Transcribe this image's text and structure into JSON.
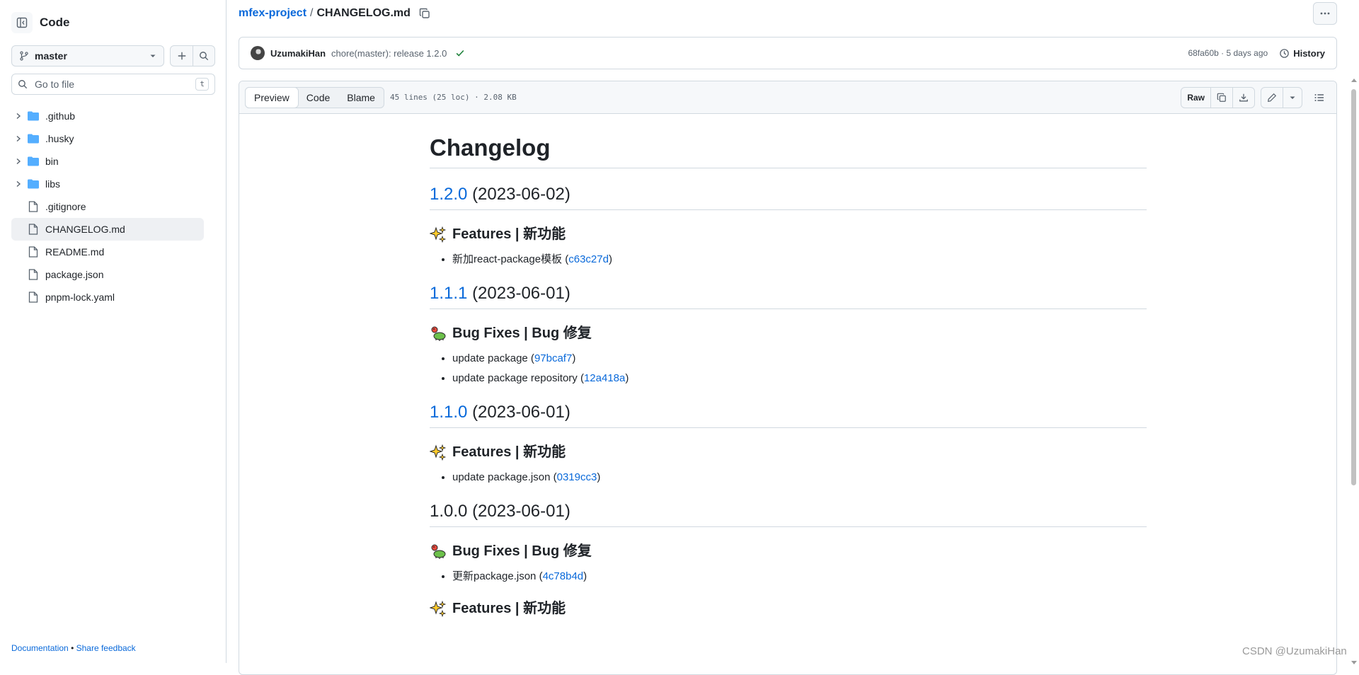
{
  "sidebar": {
    "title": "Code",
    "branch": "master",
    "goto": {
      "placeholder": "Go to file",
      "shortcut": "t"
    },
    "tree": [
      {
        "name": ".github",
        "type": "folder"
      },
      {
        "name": ".husky",
        "type": "folder"
      },
      {
        "name": "bin",
        "type": "folder"
      },
      {
        "name": "libs",
        "type": "folder"
      },
      {
        "name": ".gitignore",
        "type": "file"
      },
      {
        "name": "CHANGELOG.md",
        "type": "file",
        "active": true
      },
      {
        "name": "README.md",
        "type": "file"
      },
      {
        "name": "package.json",
        "type": "file"
      },
      {
        "name": "pnpm-lock.yaml",
        "type": "file"
      }
    ],
    "footer": {
      "documentation": "Documentation",
      "separator": "•",
      "feedback": "Share feedback"
    }
  },
  "breadcrumb": {
    "repo": "mfex-project",
    "separator": "/",
    "file": "CHANGELOG.md"
  },
  "commit": {
    "author": "UzumakiHan",
    "message": "chore(master): release 1.2.0",
    "meta": "68fa60b · 5 days ago",
    "history": "History"
  },
  "file_header": {
    "tabs": [
      "Preview",
      "Code",
      "Blame"
    ],
    "meta": "45 lines (25 loc) · 2.08 KB",
    "raw": "Raw"
  },
  "markdown": {
    "title": "Changelog",
    "sections": [
      {
        "version": "1.2.0",
        "version_link": true,
        "date": "(2023-06-02)",
        "groups": [
          {
            "emoji": "sparkles-icon",
            "title": "Features | 新功能",
            "items": [
              {
                "text": "新加react-package模板",
                "hash": "c63c27d"
              }
            ]
          }
        ]
      },
      {
        "version": "1.1.1",
        "version_link": true,
        "date": "(2023-06-01)",
        "groups": [
          {
            "emoji": "bug-icon",
            "title": "Bug Fixes | Bug 修复",
            "items": [
              {
                "text": "update package",
                "hash": "97bcaf7"
              },
              {
                "text": "update package repository",
                "hash": "12a418a"
              }
            ]
          }
        ]
      },
      {
        "version": "1.1.0",
        "version_link": true,
        "date": "(2023-06-01)",
        "groups": [
          {
            "emoji": "sparkles-icon",
            "title": "Features | 新功能",
            "items": [
              {
                "text": "update package.json",
                "hash": "0319cc3"
              }
            ]
          }
        ]
      },
      {
        "version": "1.0.0",
        "version_link": false,
        "date": "(2023-06-01)",
        "groups": [
          {
            "emoji": "bug-icon",
            "title": "Bug Fixes | Bug 修复",
            "items": [
              {
                "text": "更新package.json",
                "hash": "4c78b4d"
              }
            ]
          },
          {
            "emoji": "sparkles-icon",
            "title": "Features | 新功能",
            "items": []
          }
        ]
      }
    ]
  },
  "watermark": "CSDN @UzumakiHan",
  "colors": {
    "link": "#0969da",
    "border": "#d1d9e0",
    "muted": "#59636e",
    "success": "#1a7f37"
  }
}
